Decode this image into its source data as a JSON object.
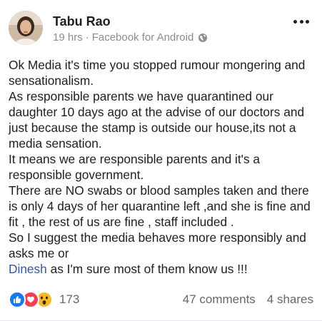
{
  "post": {
    "author": "Tabu Rao",
    "time": "19 hrs",
    "separator": "·",
    "source": "Facebook for Android",
    "privacy_icon": "globe-icon",
    "more_icon": "more-options-icon",
    "body_lines": [
      "Ok Media it's time you stopped rumour mongering and",
      "sensationalism.",
      "As responsible parents we have quarantined our",
      "daughter 10 days ago at the advise of our doctors and",
      "just because the stamp is outside our house,its not a",
      "media sensation.",
      "It means we are responsible parents and it's a",
      "responsible government.",
      "There are NO swabs or blood samples taken and there",
      "is only 4 days of her quarantine left ,and she is fine and",
      "fit , the rest of us are fine , staff included .",
      "So I suggest the media behaves more responsibly and",
      "asks me or"
    ],
    "mention": "Dinesh",
    "mention_trailing": " as I'm sure most of them know us !!!",
    "reactions": {
      "icons": [
        "like-icon",
        "love-icon",
        "wow-icon"
      ],
      "count": "173"
    },
    "comments": "47 comments",
    "shares": "4 shares"
  },
  "colors": {
    "text": "#1c1e21",
    "meta": "#8a8d91",
    "link": "#385898",
    "like": "#1877f2",
    "love": "#f33e58",
    "wow": "#f7b928"
  }
}
